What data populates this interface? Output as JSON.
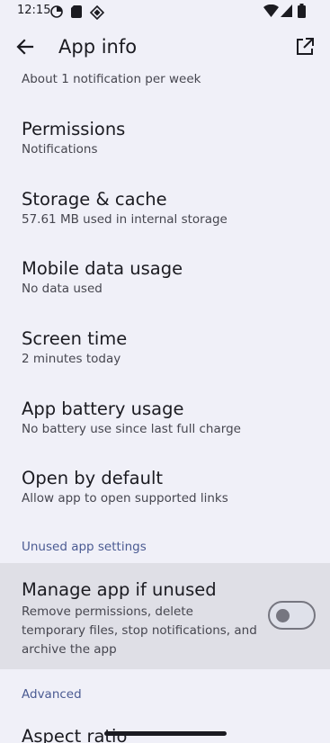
{
  "status_bar": {
    "time": "12:15"
  },
  "app_bar": {
    "title": "App info"
  },
  "top_partial": {
    "subtitle": "About 1 notification per week"
  },
  "items": [
    {
      "title": "Permissions",
      "subtitle": "Notifications"
    },
    {
      "title": "Storage & cache",
      "subtitle": "57.61 MB used in internal storage"
    },
    {
      "title": "Mobile data usage",
      "subtitle": "No data used"
    },
    {
      "title": "Screen time",
      "subtitle": "2 minutes today"
    },
    {
      "title": "App battery usage",
      "subtitle": "No battery use since last full charge"
    },
    {
      "title": "Open by default",
      "subtitle": "Allow app to open supported links"
    }
  ],
  "unused_section": {
    "header": "Unused app settings",
    "manage": {
      "title": "Manage app if unused",
      "subtitle": "Remove permissions, delete temporary files, stop notifications, and archive the app",
      "toggle_on": false
    }
  },
  "advanced_section": {
    "header": "Advanced",
    "aspect_ratio": {
      "title": "Aspect ratio"
    }
  },
  "colors": {
    "background": "#f0f0f8",
    "accent": "#4a5a92",
    "highlight": "#dfdfe6"
  }
}
